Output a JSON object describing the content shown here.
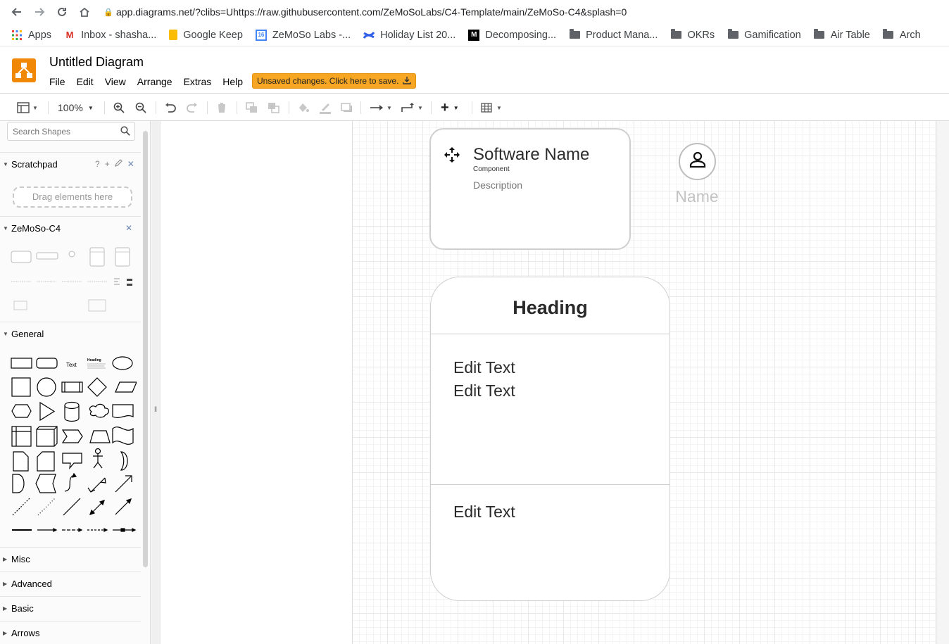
{
  "browser": {
    "url": "app.diagrams.net/?clibs=Uhttps://raw.githubusercontent.com/ZeMoSoLabs/C4-Template/main/ZeMoSo-C4&splash=0"
  },
  "bookmarks": [
    {
      "label": "Apps",
      "icon": "apps-grid-icon"
    },
    {
      "label": "Inbox - shasha...",
      "icon": "gmail-icon"
    },
    {
      "label": "Google Keep",
      "icon": "keep-icon"
    },
    {
      "label": "ZeMoSo Labs -...",
      "icon": "calendar-icon"
    },
    {
      "label": "Holiday List 20...",
      "icon": "confluence-icon"
    },
    {
      "label": "Decomposing...",
      "icon": "medium-icon"
    },
    {
      "label": "Product Mana...",
      "icon": "folder-icon"
    },
    {
      "label": "OKRs",
      "icon": "folder-icon"
    },
    {
      "label": "Gamification",
      "icon": "folder-icon"
    },
    {
      "label": "Air Table",
      "icon": "folder-icon"
    },
    {
      "label": "Arch",
      "icon": "folder-icon"
    }
  ],
  "app": {
    "title": "Untitled Diagram",
    "menu": [
      "File",
      "Edit",
      "View",
      "Arrange",
      "Extras",
      "Help"
    ],
    "unsaved_label": "Unsaved changes. Click here to save.",
    "brand_color": "#f08705"
  },
  "toolbar": {
    "zoom": "100%"
  },
  "sidebar": {
    "search_placeholder": "Search Shapes",
    "scratchpad_title": "Scratchpad",
    "scratchpad_help": "?",
    "drag_hint": "Drag elements here",
    "library_title": "ZeMoSo-C4",
    "general_title": "General",
    "general_text_shape": "Text",
    "general_heading_shape": "Heading",
    "collapsed_sections": [
      "Misc",
      "Advanced",
      "Basic",
      "Arrows"
    ]
  },
  "canvas": {
    "component": {
      "title": "Software Name",
      "type": "Component",
      "description": "Description"
    },
    "person": {
      "name": "Name"
    },
    "container": {
      "heading": "Heading",
      "texts": [
        "Edit Text",
        "Edit Text",
        "Edit Text"
      ]
    }
  }
}
